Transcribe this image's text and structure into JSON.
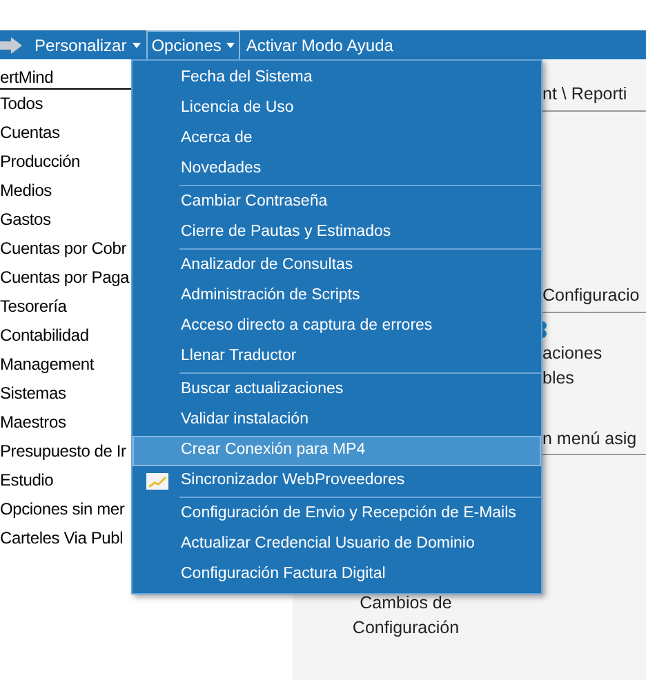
{
  "menubar": {
    "items": [
      {
        "label": "Personalizar",
        "dropdown": true,
        "selected": false
      },
      {
        "label": "Opciones",
        "dropdown": true,
        "selected": true
      },
      {
        "label": "Activar Modo Ayuda",
        "dropdown": false,
        "selected": false
      }
    ]
  },
  "sidebar": {
    "header": "ertMind",
    "items": [
      "Todos",
      "Cuentas",
      "Producción",
      "Medios",
      "Gastos",
      "Cuentas por Cobr",
      "Cuentas por Paga",
      "Tesorería",
      "Contabilidad",
      "Management",
      "Sistemas",
      "Maestros",
      "Presupuesto de Ir",
      "Estudio",
      "Opciones sin mer",
      "Carteles Via Publ"
    ]
  },
  "content": {
    "breadcrumb": "nt \\ Reporti",
    "section_1": "Configuracio",
    "tile_1": [
      "aciones",
      "bles"
    ],
    "section_2": "n menú asig",
    "tile_2": [
      "Cambios de",
      "Configuración"
    ]
  },
  "menu": {
    "groups": [
      [
        {
          "label": "Fecha del Sistema",
          "kind": "plain",
          "selected": false
        },
        {
          "label": "Licencia de Uso",
          "kind": "plain",
          "selected": false
        },
        {
          "label": "Acerca de",
          "kind": "plain",
          "selected": false
        },
        {
          "label": "Novedades",
          "kind": "plain",
          "selected": false
        }
      ],
      [
        {
          "label": "Cambiar Contraseña",
          "kind": "plain",
          "selected": false
        },
        {
          "label": "Cierre de Pautas y Estimados",
          "kind": "plain",
          "selected": false
        }
      ],
      [
        {
          "label": "Analizador de Consultas",
          "kind": "plain",
          "selected": false
        },
        {
          "label": "Administración de Scripts",
          "kind": "plain",
          "selected": false
        },
        {
          "label": "Acceso directo a captura de errores",
          "kind": "plain",
          "selected": false
        },
        {
          "label": "Llenar Traductor",
          "kind": "plain",
          "selected": false
        }
      ],
      [
        {
          "label": "Buscar actualizaciones",
          "kind": "plain",
          "selected": false
        },
        {
          "label": "Validar instalación",
          "kind": "plain",
          "selected": false
        },
        {
          "label": "Crear Conexión para MP4",
          "kind": "plain",
          "selected": true
        },
        {
          "label": "Sincronizador WebProveedores",
          "kind": "chart",
          "selected": false
        }
      ],
      [
        {
          "label": "Configuración de Envio y Recepción de E-Mails",
          "kind": "plain",
          "selected": false
        },
        {
          "label": "Actualizar Credencial Usuario de Dominio",
          "kind": "plain",
          "selected": false
        },
        {
          "label": "Configuración Factura Digital",
          "kind": "plain",
          "selected": false
        }
      ]
    ]
  }
}
